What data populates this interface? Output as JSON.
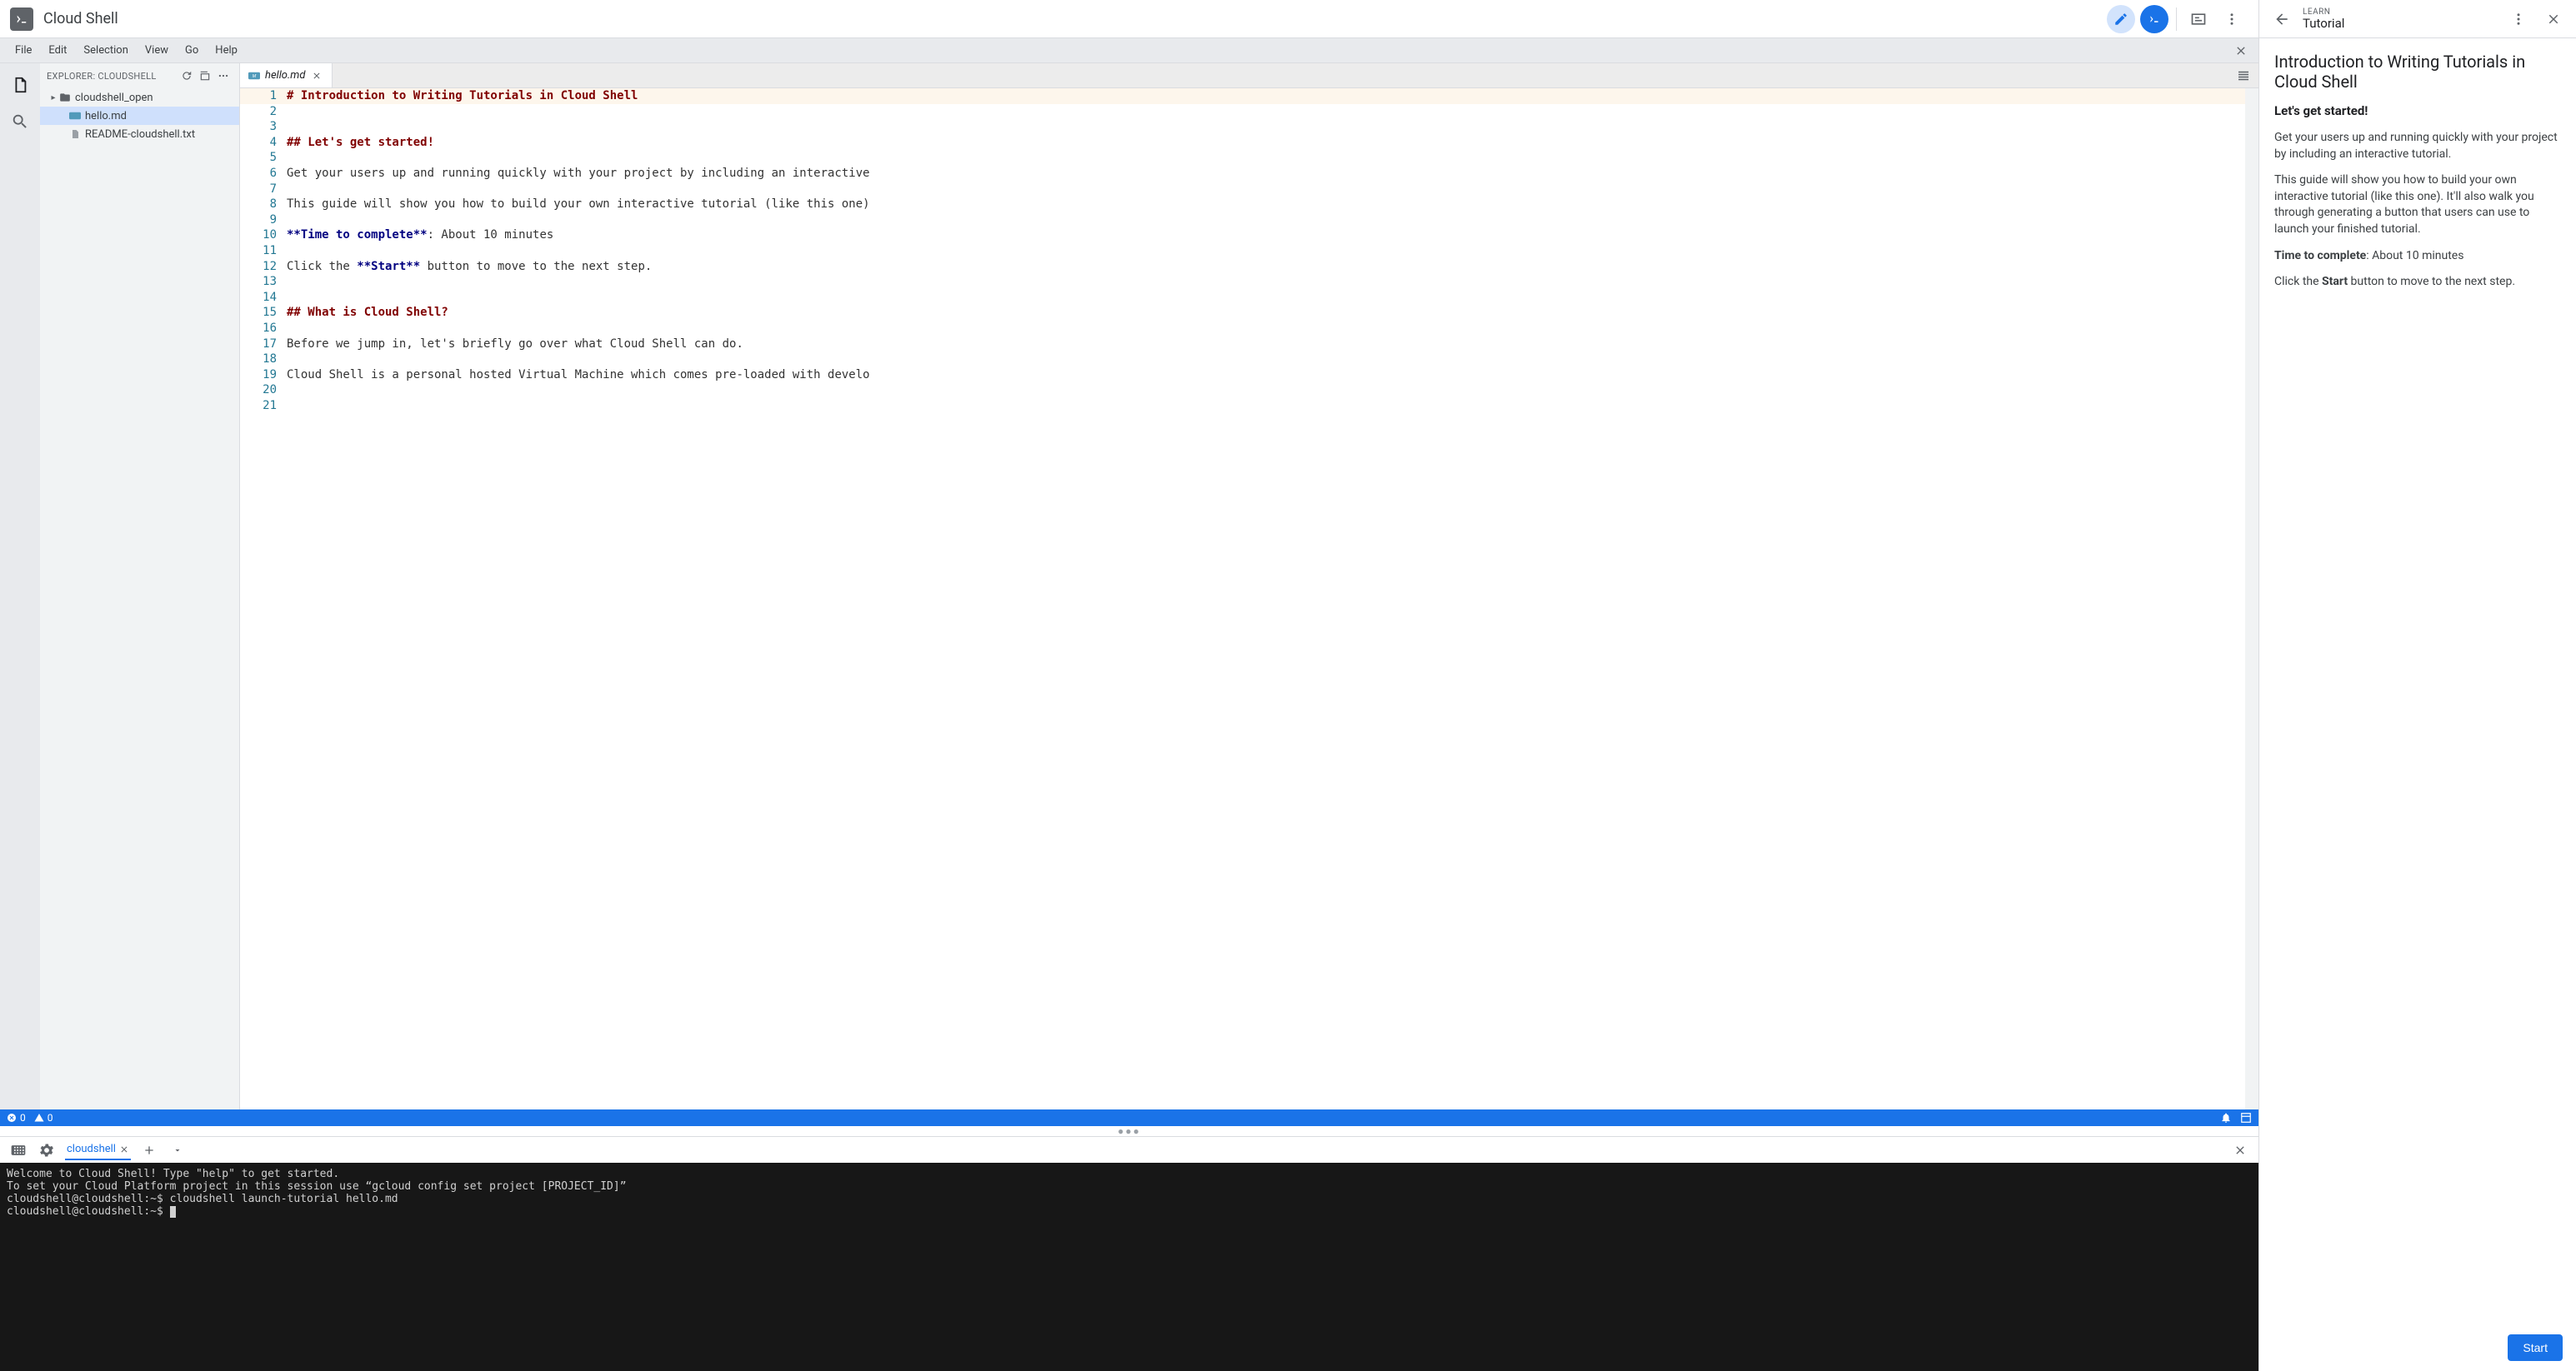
{
  "app": {
    "title": "Cloud Shell"
  },
  "menubar": {
    "items": [
      "File",
      "Edit",
      "Selection",
      "View",
      "Go",
      "Help"
    ]
  },
  "explorer": {
    "title": "EXPLORER: CLOUDSHELL",
    "tree": [
      {
        "label": "cloudshell_open",
        "type": "folder",
        "depth": 0
      },
      {
        "label": "hello.md",
        "type": "md",
        "depth": 1,
        "selected": true
      },
      {
        "label": "README-cloudshell.txt",
        "type": "file",
        "depth": 1
      }
    ]
  },
  "editor": {
    "tab": {
      "label": "hello.md"
    },
    "lines": [
      {
        "n": 1,
        "type": "h",
        "text": "# Introduction to Writing Tutorials in Cloud Shell"
      },
      {
        "n": 2,
        "type": "",
        "text": ""
      },
      {
        "n": 3,
        "type": "",
        "text": ""
      },
      {
        "n": 4,
        "type": "h",
        "text": "## Let's get started!"
      },
      {
        "n": 5,
        "type": "",
        "text": ""
      },
      {
        "n": 6,
        "type": "",
        "text": "Get your users up and running quickly with your project by including an interactive"
      },
      {
        "n": 7,
        "type": "",
        "text": ""
      },
      {
        "n": 8,
        "type": "",
        "text": "This guide will show you how to build your own interactive tutorial (like this one)"
      },
      {
        "n": 9,
        "type": "",
        "text": ""
      },
      {
        "n": 10,
        "type": "mix",
        "prefix": "**Time to complete**",
        "rest": ": About 10 minutes"
      },
      {
        "n": 11,
        "type": "",
        "text": ""
      },
      {
        "n": 12,
        "type": "mix",
        "prefix_plain": "Click the ",
        "bold": "**Start**",
        "rest": " button to move to the next step."
      },
      {
        "n": 13,
        "type": "",
        "text": ""
      },
      {
        "n": 14,
        "type": "",
        "text": ""
      },
      {
        "n": 15,
        "type": "h",
        "text": "## What is Cloud Shell?"
      },
      {
        "n": 16,
        "type": "",
        "text": ""
      },
      {
        "n": 17,
        "type": "",
        "text": "Before we jump in, let's briefly go over what Cloud Shell can do."
      },
      {
        "n": 18,
        "type": "",
        "text": ""
      },
      {
        "n": 19,
        "type": "",
        "text": "Cloud Shell is a personal hosted Virtual Machine which comes pre-loaded with develo"
      },
      {
        "n": 20,
        "type": "",
        "text": ""
      },
      {
        "n": 21,
        "type": "",
        "text": ""
      }
    ]
  },
  "statusbar": {
    "errors": "0",
    "warnings": "0"
  },
  "terminal": {
    "tab": "cloudshell",
    "lines": [
      "Welcome to Cloud Shell! Type \"help\" to get started.",
      "To set your Cloud Platform project in this session use “gcloud config set project [PROJECT_ID]”",
      "cloudshell@cloudshell:~$ cloudshell launch-tutorial hello.md",
      "cloudshell@cloudshell:~$ "
    ]
  },
  "tutorial": {
    "eyebrow": "LEARN",
    "name": "Tutorial",
    "title": "Introduction to Writing Tutorials in Cloud Shell",
    "subtitle": "Let's get started!",
    "p1": "Get your users up and running quickly with your project by including an interactive tutorial.",
    "p2": "This guide will show you how to build your own interactive tutorial (like this one). It'll also walk you through generating a button that users can use to launch your finished tutorial.",
    "time_label": "Time to complete",
    "time_value": ": About 10 minutes",
    "p3a": "Click the ",
    "p3b": "Start",
    "p3c": " button to move to the next step.",
    "start": "Start"
  }
}
